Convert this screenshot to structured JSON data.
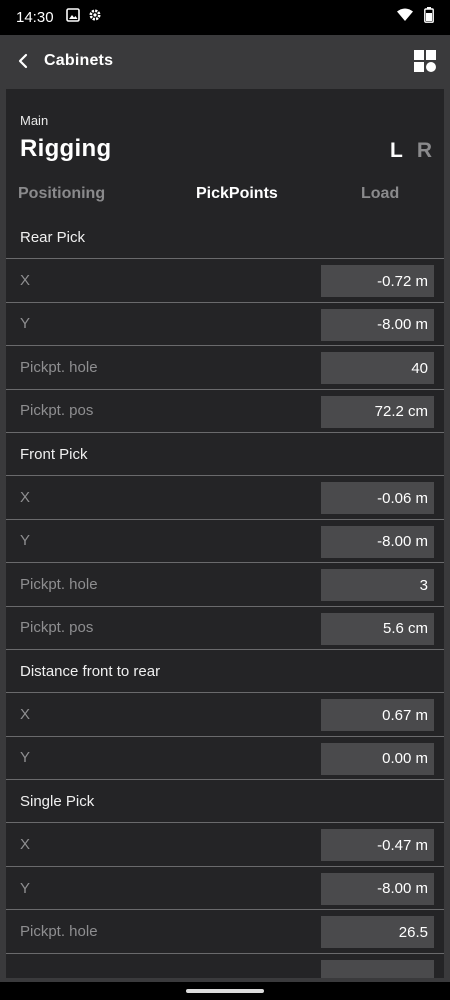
{
  "status": {
    "time": "14:30"
  },
  "appbar": {
    "title": "Cabinets"
  },
  "header": {
    "subtitle": "Main",
    "title": "Rigging",
    "left_label": "L",
    "right_label": "R"
  },
  "tabs": [
    {
      "label": "Positioning",
      "active": false
    },
    {
      "label": "PickPoints",
      "active": true
    },
    {
      "label": "Load",
      "active": false
    }
  ],
  "rows": [
    {
      "type": "section",
      "label": "Rear Pick"
    },
    {
      "type": "field",
      "label": "X",
      "value": "-0.72 m"
    },
    {
      "type": "field",
      "label": "Y",
      "value": "-8.00 m"
    },
    {
      "type": "field",
      "label": "Pickpt. hole",
      "value": "40"
    },
    {
      "type": "field",
      "label": "Pickpt. pos",
      "value": "72.2 cm"
    },
    {
      "type": "section",
      "label": "Front Pick"
    },
    {
      "type": "field",
      "label": "X",
      "value": "-0.06 m"
    },
    {
      "type": "field",
      "label": "Y",
      "value": "-8.00 m"
    },
    {
      "type": "field",
      "label": "Pickpt. hole",
      "value": "3"
    },
    {
      "type": "field",
      "label": "Pickpt. pos",
      "value": "5.6 cm"
    },
    {
      "type": "section",
      "label": "Distance front to rear"
    },
    {
      "type": "field",
      "label": "X",
      "value": "0.67 m"
    },
    {
      "type": "field",
      "label": "Y",
      "value": "0.00 m"
    },
    {
      "type": "section",
      "label": "Single Pick"
    },
    {
      "type": "field",
      "label": "X",
      "value": "-0.47 m"
    },
    {
      "type": "field",
      "label": "Y",
      "value": "-8.00 m"
    },
    {
      "type": "field",
      "label": "Pickpt. hole",
      "value": "26.5"
    },
    {
      "type": "field",
      "label": "",
      "value": ""
    }
  ],
  "icons": {
    "back": "chevron-left-icon",
    "grid": "grid-icon",
    "wifi": "wifi-icon",
    "battery": "battery-icon",
    "image": "image-icon",
    "settings": "gear-icon"
  }
}
